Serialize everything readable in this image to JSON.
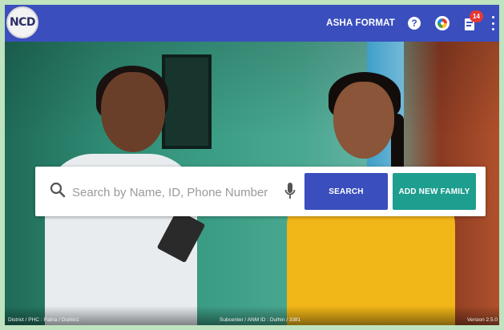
{
  "header": {
    "logo_text": "NCD",
    "brand": "ASHA FORMAT",
    "help_glyph": "?",
    "notification_count": "14",
    "colors": {
      "bar": "#3a4fbd"
    }
  },
  "search": {
    "placeholder": "Search by Name, ID, Phone Number ...",
    "search_label": "SEARCH",
    "add_label": "ADD NEW FAMILY",
    "colors": {
      "search_button": "#3a4fbd",
      "add_button": "#1e9e8e"
    }
  },
  "footer": {
    "left": "District / PHC : Patna / Dulhin1",
    "middle": "Subcenter / ANM ID : Dulhin / 3381",
    "right": "Version 2.5.0"
  },
  "icons": [
    "logo",
    "help-icon",
    "sync-icon",
    "notifications-icon",
    "more-options-icon",
    "search-icon",
    "mic-icon"
  ]
}
